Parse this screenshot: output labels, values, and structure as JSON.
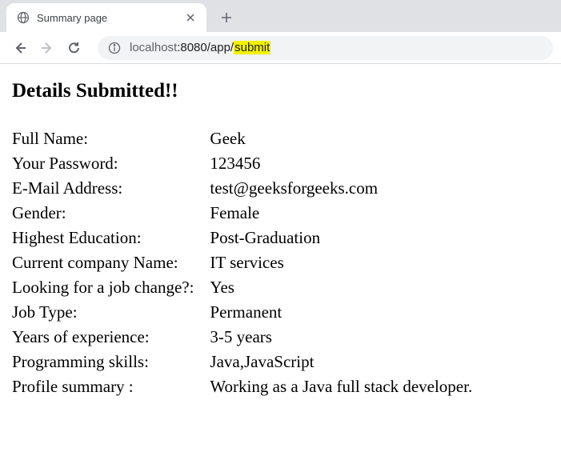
{
  "browser": {
    "tab": {
      "title": "Summary page"
    },
    "url": {
      "host": "localhost",
      "port_path": ":8080/app/",
      "highlighted": "submit"
    }
  },
  "page": {
    "heading": "Details Submitted!!",
    "rows": [
      {
        "label": "Full Name:",
        "value": "Geek"
      },
      {
        "label": "Your Password:",
        "value": "123456"
      },
      {
        "label": "E-Mail Address:",
        "value": "test@geeksforgeeks.com"
      },
      {
        "label": "Gender:",
        "value": "Female"
      },
      {
        "label": "Highest Education:",
        "value": "Post-Graduation"
      },
      {
        "label": "Current company Name:",
        "value": "IT services"
      },
      {
        "label": "Looking for a job change?:",
        "value": "Yes"
      },
      {
        "label": "Job Type:",
        "value": "Permanent"
      },
      {
        "label": "Years of experience:",
        "value": "3-5 years"
      },
      {
        "label": "Programming skills:",
        "value": "Java,JavaScript"
      },
      {
        "label": "Profile summary :",
        "value": "Working as a Java full stack developer."
      }
    ]
  }
}
